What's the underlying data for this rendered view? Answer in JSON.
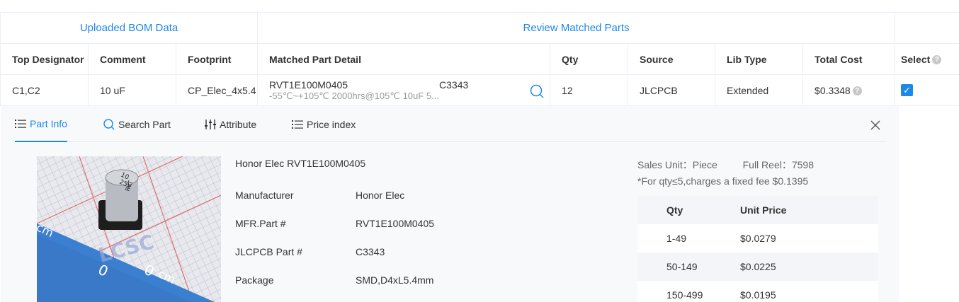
{
  "table": {
    "group_uploaded": "Uploaded BOM Data",
    "group_review": "Review Matched Parts",
    "headers": {
      "top_designator": "Top Designator",
      "comment": "Comment",
      "footprint": "Footprint",
      "matched_part_detail": "Matched Part Detail",
      "qty": "Qty",
      "source": "Source",
      "lib_type": "Lib Type",
      "total_cost": "Total Cost",
      "select": "Select"
    },
    "row": {
      "designator": "C1,C2",
      "comment": "10 uF",
      "footprint": "CP_Elec_4x5.4",
      "mfr_part": "RVT1E100M0405",
      "lcsc_part": "C3343",
      "description": "-55℃~+105℃ 2000hrs@105℃ 10uF 5...",
      "qty": "12",
      "source": "JLCPCB",
      "lib_type": "Extended",
      "total_cost": "$0.3348",
      "selected": true
    }
  },
  "tabs": [
    {
      "label": "Part Info",
      "icon": "list-icon",
      "active": true
    },
    {
      "label": "Search Part",
      "icon": "search-icon",
      "active": false
    },
    {
      "label": "Attribute",
      "icon": "sliders-icon",
      "active": false
    },
    {
      "label": "Price index",
      "icon": "list-icon",
      "active": false
    }
  ],
  "part_info": {
    "title": "Honor Elec RVT1E100M0405",
    "fields": [
      {
        "label": "Manufacturer",
        "value": "Honor Elec"
      },
      {
        "label": "MFR.Part #",
        "value": "RVT1E100M0405"
      },
      {
        "label": "JLCPCB Part #",
        "value": "C3343"
      },
      {
        "label": "Package",
        "value": "SMD,D4xL5.4mm"
      }
    ],
    "image_marking": [
      "10",
      "25V",
      "RVT"
    ],
    "image_watermark": "LCSC",
    "image_scale_labels": [
      "cm",
      "0",
      "0",
      "cm"
    ]
  },
  "pricing": {
    "sales_unit_label": "Sales Unit：Piece",
    "full_reel_label": "Full Reel：7598",
    "fixed_fee_note": "*For qty≤5,charges a fixed fee $0.1395",
    "header_qty": "Qty",
    "header_price": "Unit Price",
    "rows": [
      {
        "qty": "1-49",
        "price": "$0.0279"
      },
      {
        "qty": "50-149",
        "price": "$0.0225"
      },
      {
        "qty": "150-499",
        "price": "$0.0195"
      }
    ]
  },
  "colors": {
    "accent": "#1e88e5",
    "muted": "#999999",
    "panel": "#f8f9fb"
  }
}
